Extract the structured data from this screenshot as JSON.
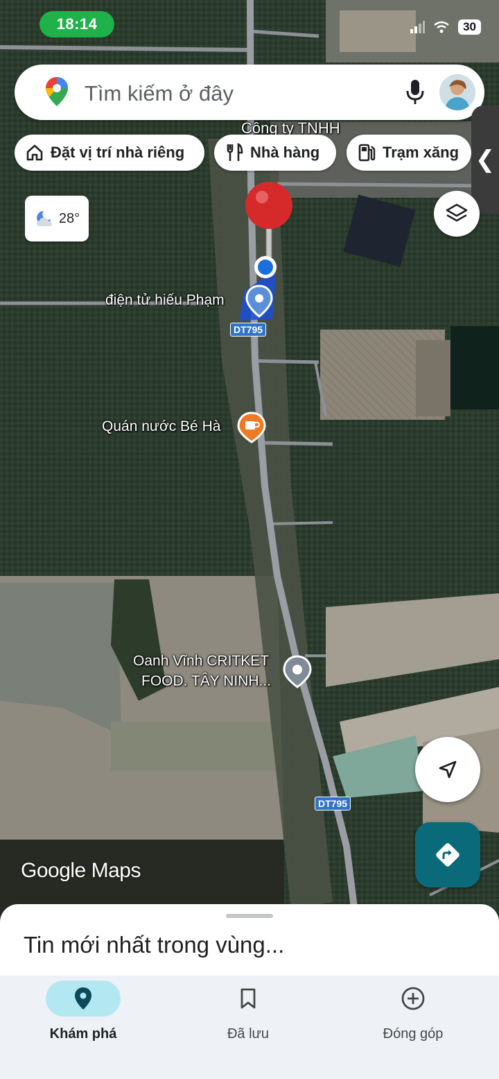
{
  "status_bar": {
    "time": "18:14",
    "battery": "30"
  },
  "search": {
    "placeholder": "Tìm kiếm ở đây"
  },
  "chips": [
    {
      "label": "Đặt vị trí nhà riêng",
      "icon": "home-icon"
    },
    {
      "label": "Nhà hàng",
      "icon": "restaurant-icon"
    },
    {
      "label": "Trạm xăng",
      "icon": "gas-station-icon"
    }
  ],
  "weather": {
    "temperature": "28°",
    "icon": "night-cloud-icon"
  },
  "map": {
    "labels": {
      "company": "Công ty TNHH",
      "place_1": "điện tử hiếu Phạm",
      "place_2": "Quán nước Bé Hà",
      "place_3_line1": "Oanh Vĩnh CRITKET",
      "place_3_line2": "FOOD. TÂY NINH..."
    },
    "road_shields": [
      "DT795",
      "DT795"
    ],
    "watermark": {
      "google": "Google",
      "maps": "Maps"
    },
    "colors": {
      "road": "#8d9096",
      "pin_red": "#d62a2a",
      "location_blue": "#1a6fdc"
    }
  },
  "sheet": {
    "title": "Tin mới nhất trong vùng..."
  },
  "nav": [
    {
      "label": "Khám phá",
      "icon": "explore-pin-icon",
      "active": true
    },
    {
      "label": "Đã lưu",
      "icon": "bookmark-icon",
      "active": false
    },
    {
      "label": "Đóng góp",
      "icon": "add-circle-icon",
      "active": false
    }
  ]
}
